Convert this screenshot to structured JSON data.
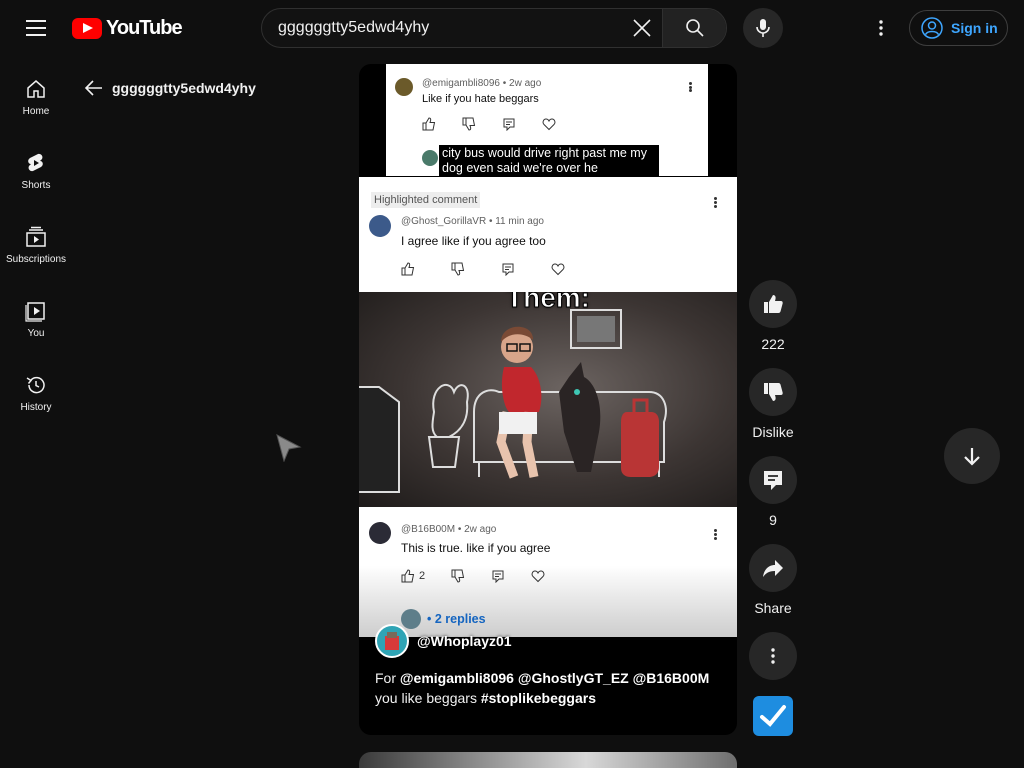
{
  "header": {
    "logo_text": "YouTube",
    "search_value": "ggggggtty5edwd4yhy",
    "signin_label": "Sign in"
  },
  "sidebar": {
    "items": [
      {
        "label": "Home",
        "icon": "home-icon"
      },
      {
        "label": "Shorts",
        "icon": "shorts-icon"
      },
      {
        "label": "Subscriptions",
        "icon": "subscriptions-icon"
      },
      {
        "label": "You",
        "icon": "you-icon"
      },
      {
        "label": "History",
        "icon": "history-icon"
      }
    ]
  },
  "back": {
    "title": "ggggggtty5edwd4yhy"
  },
  "short": {
    "comment1": {
      "handle": "@emigambli8096 • 2w ago",
      "text": "Like if you hate beggars"
    },
    "caption": "city bus would drive right past me my dog even said we're over he",
    "highlight_label": "Highlighted comment",
    "comment2": {
      "handle": "@Ghost_GorillaVR • 11 min ago",
      "text": "I agree like if you agree too"
    },
    "scene_caption": "Them:",
    "comment3": {
      "handle": "@B16B00M • 2w ago",
      "text": "This is true. like if you agree",
      "likes": "2",
      "replies": "• 2 replies"
    },
    "channel": "@Whoplayz01",
    "description": {
      "prefix": "For ",
      "mentions": "@emigambli8096 @GhostlyGT_EZ @B16B00M",
      "middle": " you like beggars ",
      "hashtag": "#stoplikebeggars"
    }
  },
  "actions": {
    "like_count": "222",
    "dislike_label": "Dislike",
    "comment_count": "9",
    "share_label": "Share"
  },
  "colors": {
    "background": "#0f0f0f",
    "brand_red": "#ff0000",
    "link_blue": "#3ea6ff",
    "button_gray": "#272727"
  }
}
